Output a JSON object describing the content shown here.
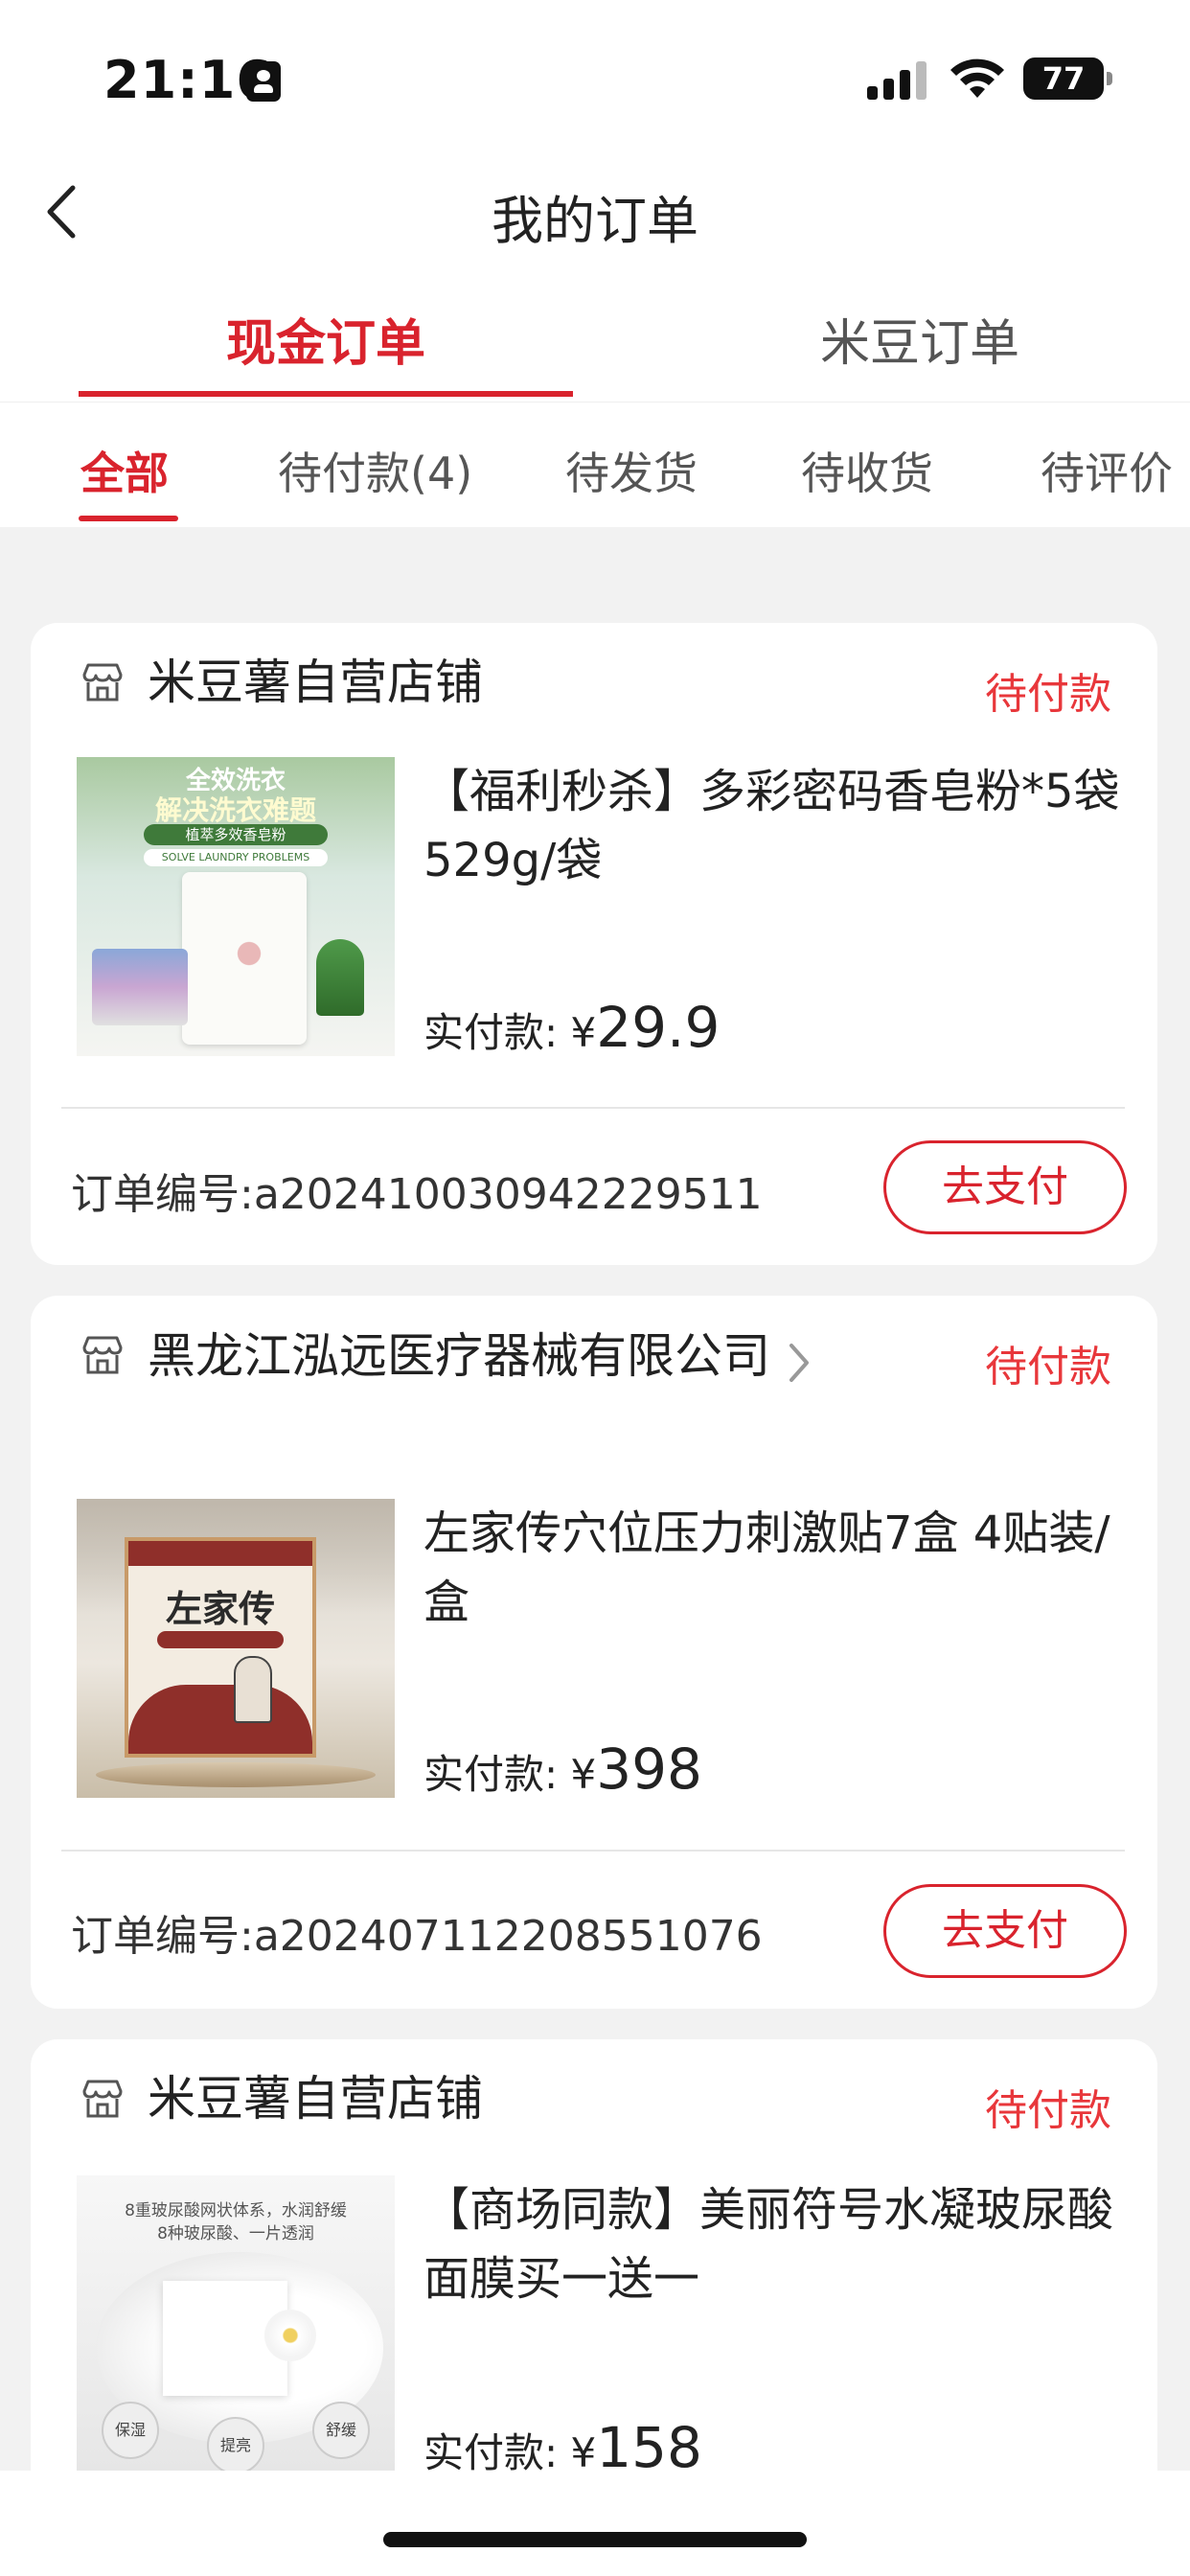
{
  "status_bar": {
    "time": "21:16",
    "battery": "77"
  },
  "nav": {
    "title": "我的订单"
  },
  "top_tabs": [
    {
      "label": "现金订单"
    },
    {
      "label": "米豆订单"
    }
  ],
  "sub_tabs": [
    {
      "label": "全部"
    },
    {
      "label": "待付款(4)"
    },
    {
      "label": "待发货"
    },
    {
      "label": "待收货"
    },
    {
      "label": "待评价"
    }
  ],
  "orders": [
    {
      "store": "米豆薯自营店铺",
      "status": "待付款",
      "thumb": {
        "headline1": "全效洗衣",
        "headline2": "解决洗衣难题",
        "badge": "植萃多效香皂粉",
        "banner": "SOLVE LAUNDRY PROBLEMS"
      },
      "title": "【福利秒杀】多彩密码香皂粉*5袋 529g/袋",
      "price_label": "实付款: ",
      "currency": "¥",
      "price": "29.9",
      "order_no": "订单编号:a202410030942229511",
      "button": "去支付"
    },
    {
      "store": "黑龙江泓远医疗器械有限公司",
      "status": "待付款",
      "thumb": {
        "brand": "左家传"
      },
      "title": "左家传穴位压力刺激贴7盒 4贴装/盒",
      "price_label": "实付款: ",
      "currency": "¥",
      "price": "398",
      "order_no": "订单编号:a202407112208551076",
      "button": "去支付"
    },
    {
      "store": "米豆薯自营店铺",
      "status": "待付款",
      "thumb": {
        "line1": "8重玻尿酸网状体系，水润舒缓",
        "line2": "8种玻尿酸、一片透润",
        "tag1": "保湿",
        "tag2": "提亮",
        "tag3": "舒缓"
      },
      "title": "【商场同款】美丽符号水凝玻尿酸面膜买一送一",
      "price_label": "实付款: ",
      "currency": "¥",
      "price": "158"
    }
  ],
  "colors": {
    "accent": "#d9232d",
    "status": "#e8373b",
    "background": "#f2f2f2"
  }
}
